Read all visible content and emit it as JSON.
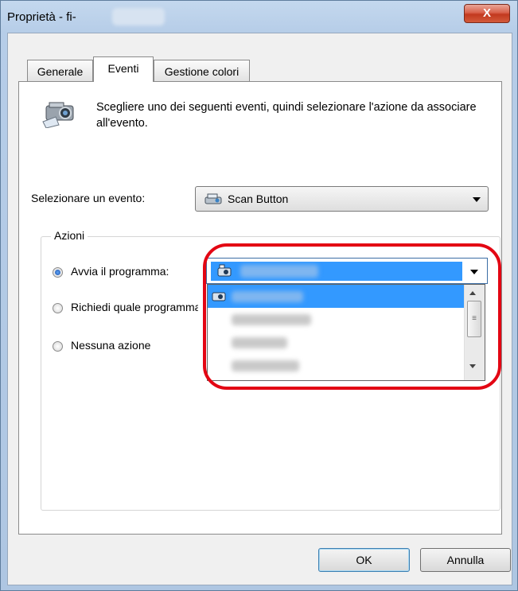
{
  "window": {
    "title": "Proprietà - fi-",
    "close_label": "X"
  },
  "tabs": [
    {
      "label": "Generale",
      "selected": false
    },
    {
      "label": "Eventi",
      "selected": true
    },
    {
      "label": "Gestione colori",
      "selected": false
    }
  ],
  "description": "Scegliere uno dei seguenti eventi, quindi selezionare l'azione da associare all'evento.",
  "event_select": {
    "label": "Selezionare un evento:",
    "value": "Scan Button"
  },
  "actions": {
    "group_label": "Azioni",
    "options": [
      {
        "label": "Avvia il programma:",
        "checked": true
      },
      {
        "label": "Richiedi quale programma",
        "checked": false
      },
      {
        "label": "Nessuna azione",
        "checked": false
      }
    ]
  },
  "footer": {
    "ok_label": "OK",
    "cancel_label": "Annulla"
  },
  "colors": {
    "accent": "#3399ff",
    "highlight": "#e30613"
  }
}
